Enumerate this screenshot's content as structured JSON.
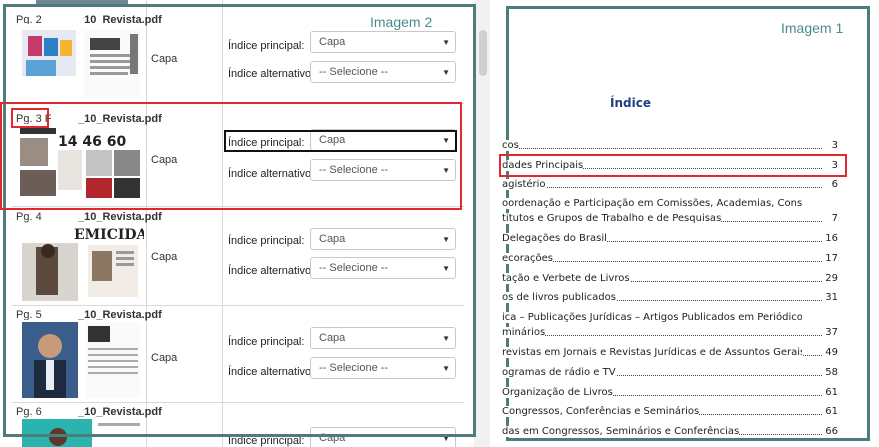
{
  "captions": {
    "left": "Imagem 2",
    "right": "Imagem 1"
  },
  "form": {
    "main_index_label": "Índice principal:",
    "alt_index_label": "Índice alternativo:"
  },
  "rows": [
    {
      "page": "Pg. 2",
      "file": "_10_Revista.pdf",
      "tag": "Capa",
      "main_value": "Capa",
      "alt_value": "-- Selecione --"
    },
    {
      "page": "Pg. 3 F",
      "file": "_10_Revista.pdf",
      "tag": "Capa",
      "main_value": "Capa",
      "alt_value": "-- Selecione --"
    },
    {
      "page": "Pg. 4",
      "file": "_10_Revista.pdf",
      "tag": "Capa",
      "main_value": "Capa",
      "alt_value": "-- Selecione --"
    },
    {
      "page": "Pg. 5",
      "file": "_10_Revista.pdf",
      "tag": "Capa",
      "main_value": "Capa",
      "alt_value": "-- Selecione --"
    },
    {
      "page": "Pg. 6",
      "file": "_10_Revista.pdf",
      "tag": "",
      "main_value": "Capa",
      "alt_value": ""
    }
  ],
  "thumb_texts": {
    "row3_nums": "14   46 60",
    "row4_word": "EMICIDA"
  },
  "document": {
    "title": "Índice",
    "toc": [
      {
        "text": "cos",
        "page": "3"
      },
      {
        "text": "dades Principais",
        "page": "3"
      },
      {
        "text": "agistério",
        "page": "6"
      },
      {
        "text": "oordenação e Participação em Comissões, Academias, Conselhos,",
        "page": ""
      },
      {
        "text": "titutos e Grupos de Trabalho e de Pesquisas",
        "page": "7"
      },
      {
        "text": "Delegações do Brasil",
        "page": "16"
      },
      {
        "text": "ecorações",
        "page": "17"
      },
      {
        "text": "tação e Verbete de Livros",
        "page": "29"
      },
      {
        "text": "os de livros publicados",
        "page": "31"
      },
      {
        "text": "ica – Publicações Jurídicas – Artigos Publicados em Periódicos e Anais de",
        "page": ""
      },
      {
        "text": "minários",
        "page": "37"
      },
      {
        "text": "revistas em Jornais e Revistas Jurídicas e de Assuntos Gerais",
        "page": "49"
      },
      {
        "text": "ogramas de rádio e TV",
        "page": "58"
      },
      {
        "text": "Organização de Livros",
        "page": "61"
      },
      {
        "text": "Congressos, Conferências e Seminários",
        "page": "61"
      },
      {
        "text": "das em Congressos, Seminários e Conferências",
        "page": "66"
      }
    ]
  },
  "colors": {
    "frame": "#4f7b7b",
    "highlight": "#e0282e",
    "doc_title": "#1f3f86"
  }
}
